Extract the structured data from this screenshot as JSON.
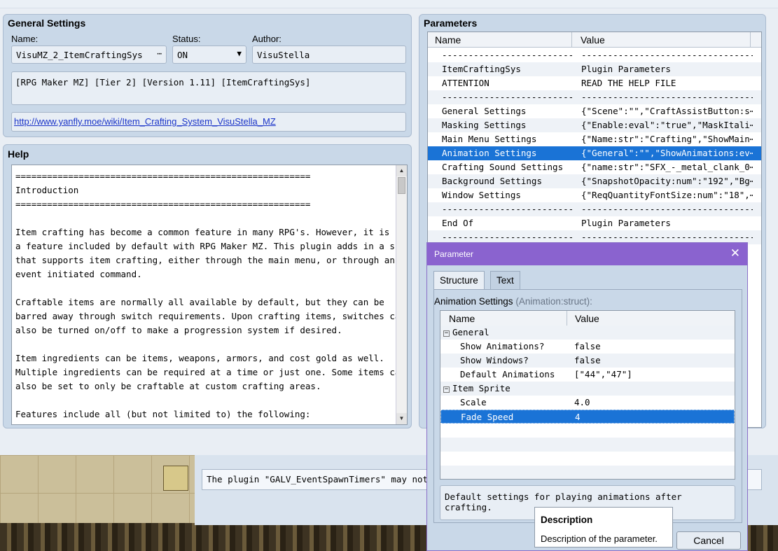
{
  "general": {
    "title": "General Settings",
    "name_label": "Name:",
    "name_value": "VisuMZ_2_ItemCraftingSys",
    "name_button": "⋯",
    "status_label": "Status:",
    "status_value": "ON",
    "author_label": "Author:",
    "author_value": "VisuStella",
    "description": "[RPG Maker MZ] [Tier 2] [Version 1.11] [ItemCraftingSys]",
    "url": "http://www.yanfly.moe/wiki/Item_Crafting_System_VisuStella_MZ"
  },
  "help": {
    "title": "Help",
    "text": "========================================================\nIntroduction\n========================================================\n\nItem crafting has become a common feature in many RPG's. However, it is not\na feature included by default with RPG Maker MZ. This plugin adds in a scene\nthat supports item crafting, either through the main menu, or through an\nevent initiated command.\n\nCraftable items are normally all available by default, but they can be\nbarred away through switch requirements. Upon crafting items, switches can\nalso be turned on/off to make a progression system if desired.\n\nItem ingredients can be items, weapons, armors, and cost gold as well.\nMultiple ingredients can be required at a time or just one. Some items can\nalso be set to only be craftable at custom crafting areas.\n\nFeatures include all (but not limited to) the following:"
  },
  "params": {
    "title": "Parameters",
    "col_name": "Name",
    "col_value": "Value",
    "rows": [
      {
        "name": "-------------------------",
        "value": "---------------------------------"
      },
      {
        "name": "ItemCraftingSys",
        "value": "Plugin Parameters"
      },
      {
        "name": "ATTENTION",
        "value": "READ THE HELP FILE"
      },
      {
        "name": "-------------------------",
        "value": "---------------------------------"
      },
      {
        "name": "General Settings",
        "value": "{\"Scene\":\"\",\"CraftAssistButton:s⋯"
      },
      {
        "name": "Masking Settings",
        "value": "{\"Enable:eval\":\"true\",\"MaskItali⋯"
      },
      {
        "name": "Main Menu Settings",
        "value": "{\"Name:str\":\"Crafting\",\"ShowMain⋯"
      },
      {
        "name": "Animation Settings",
        "value": "{\"General\":\"\",\"ShowAnimations:ev⋯"
      },
      {
        "name": "Crafting Sound Settings",
        "value": "{\"name:str\":\"SFX_-_metal_clank_0⋯"
      },
      {
        "name": "Background Settings",
        "value": "{\"SnapshotOpacity:num\":\"192\",\"Bg⋯"
      },
      {
        "name": "Window Settings",
        "value": "{\"ReqQuantityFontSize:num\":\"18\",⋯"
      },
      {
        "name": "-------------------------",
        "value": "---------------------------------"
      },
      {
        "name": "End Of",
        "value": "Plugin Parameters"
      },
      {
        "name": "-------------------------",
        "value": "---------------------------------"
      }
    ]
  },
  "status_message": "The plugin \"GALV_EventSpawnTimers\" may not sup",
  "dialog": {
    "title": "Parameter",
    "tab_structure": "Structure",
    "tab_text": "Text",
    "struct_label": "Animation Settings",
    "struct_type": "(Animation:struct):",
    "col_name": "Name",
    "col_value": "Value",
    "rows": [
      {
        "name": "General",
        "value": "",
        "group": true
      },
      {
        "name": "Show Animations?",
        "value": "false"
      },
      {
        "name": "Show Windows?",
        "value": "false"
      },
      {
        "name": "Default Animations",
        "value": "[\"44\",\"47\"]"
      },
      {
        "name": "Item Sprite",
        "value": "",
        "group": true
      },
      {
        "name": "Scale",
        "value": "4.0"
      },
      {
        "name": "Fade Speed",
        "value": "4"
      }
    ],
    "description": "Default settings for playing animations after crafting.",
    "cancel": "Cancel",
    "tooltip_title": "Description",
    "tooltip_body": "Description of the parameter."
  }
}
